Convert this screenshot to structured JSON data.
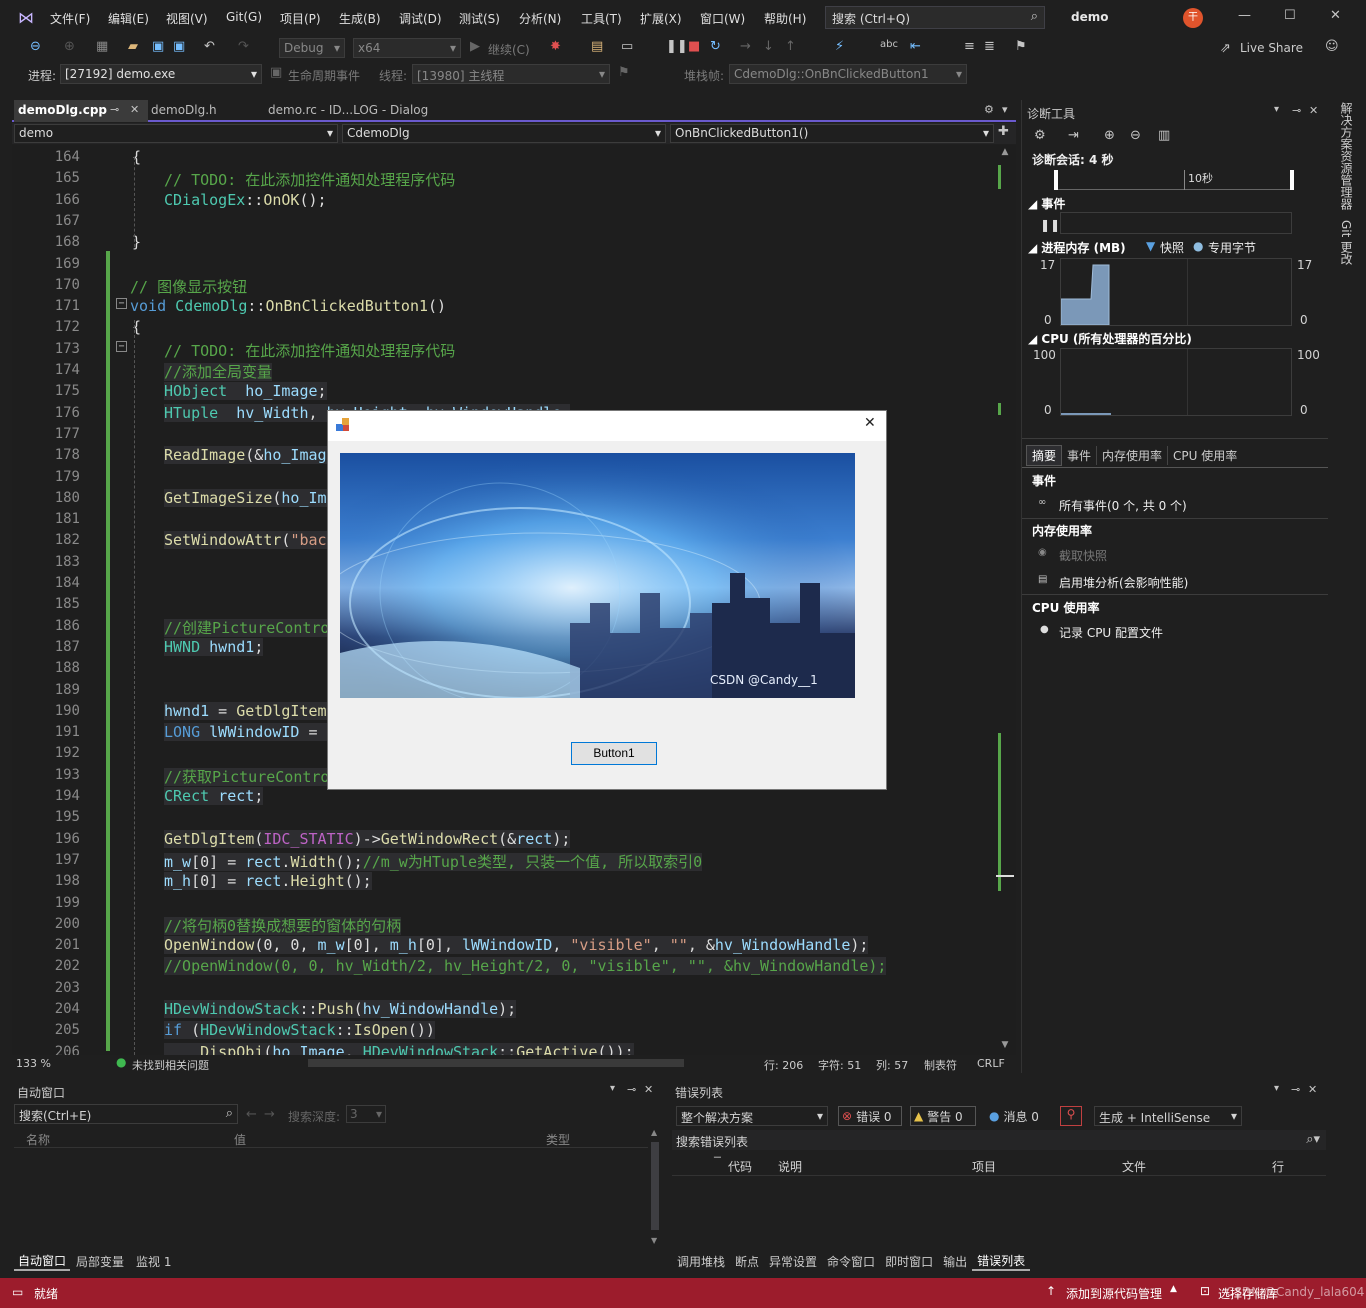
{
  "menubar": {
    "items": [
      "文件(F)",
      "编辑(E)",
      "视图(V)",
      "Git(G)",
      "项目(P)",
      "生成(B)",
      "调试(D)",
      "测试(S)",
      "分析(N)",
      "工具(T)",
      "扩展(X)",
      "窗口(W)",
      "帮助(H)"
    ],
    "search": "搜索 (Ctrl+Q)",
    "solution": "demo",
    "live_share": "Live Share"
  },
  "toolbar": {
    "config": "Debug",
    "platform": "x64",
    "continue": "继续(C)",
    "process_label": "进程:",
    "process": "[27192] demo.exe",
    "lifecycle": "生命周期事件",
    "thread_label": "线程:",
    "thread": "[13980] 主线程",
    "stack_label": "堆栈帧:",
    "stack": "CdemoDlg::OnBnClickedButton1"
  },
  "tabs": {
    "active": "demoDlg.cpp",
    "t2": "demoDlg.h",
    "t3": "demo.rc - ID...LOG - Dialog"
  },
  "nav": {
    "project": "demo",
    "class": "CdemoDlg",
    "member": "OnBnClickedButton1()"
  },
  "editor": {
    "lines": [
      {
        "n": "164",
        "html": "<span>{</span>",
        "indent": 120
      },
      {
        "n": "165",
        "html": "<span class='cm'>// TODO: 在此添加控件通知处理程序代码</span>",
        "indent": 152
      },
      {
        "n": "166",
        "html": "<span class='ty'>CDialogEx</span>::<span class='fn'>OnOK</span>();",
        "indent": 152
      },
      {
        "n": "167",
        "html": "",
        "indent": 152
      },
      {
        "n": "168",
        "html": "}",
        "indent": 120
      },
      {
        "n": "169",
        "html": "",
        "indent": 120
      },
      {
        "n": "170",
        "html": "<span class='cm'>// 图像显示按钮</span>",
        "indent": 118
      },
      {
        "n": "171",
        "html": "<span class='kw'>void</span> <span class='ty'>CdemoDlg</span>::<span class='fn'>OnBnClickedButton1</span>()",
        "indent": 118
      },
      {
        "n": "172",
        "html": "{",
        "indent": 120
      },
      {
        "n": "173",
        "html": "<span class='cm'>// TODO: 在此添加控件通知处理程序代码</span>",
        "indent": 152
      },
      {
        "n": "174",
        "html": "<span class='cm sel'>//添加全局变量</span>",
        "indent": 152
      },
      {
        "n": "175",
        "html": "<span class='sel'><span class='ty'>HObject</span>  <span class='vr'>ho_Image</span>;</span>",
        "indent": 152
      },
      {
        "n": "176",
        "html": "<span class='sel'><span class='ty'>HTuple</span>  <span class='vr'>hv_Width</span>, <span class='vr'>hv_Height</span>, <span class='vr'>hv_WindowHandle</span>;</span>",
        "indent": 152
      },
      {
        "n": "177",
        "html": "",
        "indent": 152
      },
      {
        "n": "178",
        "html": "<span class='sel'><span class='fn'>ReadImage</span>(&amp;<span class='vr'>ho_Image</span></span>",
        "indent": 152
      },
      {
        "n": "179",
        "html": "",
        "indent": 152
      },
      {
        "n": "180",
        "html": "<span class='sel'><span class='fn'>GetImageSize</span>(<span class='vr'>ho_Ima</span></span>",
        "indent": 152
      },
      {
        "n": "181",
        "html": "",
        "indent": 152
      },
      {
        "n": "182",
        "html": "<span class='sel'><span class='fn'>SetWindowAttr</span>(<span class='st'>\"back</span></span>",
        "indent": 152
      },
      {
        "n": "183",
        "html": "",
        "indent": 152
      },
      {
        "n": "184",
        "html": "",
        "indent": 152
      },
      {
        "n": "185",
        "html": "",
        "indent": 152
      },
      {
        "n": "186",
        "html": "<span class='cm sel'>//创建PictureContro</span>",
        "indent": 152
      },
      {
        "n": "187",
        "html": "<span class='sel'><span class='ty'>HWND</span> <span class='vr'>hwnd1</span>;</span>",
        "indent": 152
      },
      {
        "n": "188",
        "html": "",
        "indent": 152
      },
      {
        "n": "189",
        "html": "",
        "indent": 152
      },
      {
        "n": "190",
        "html": "<span class='sel'><span class='vr'>hwnd1</span> = <span class='fn'>GetDlgItem</span></span>",
        "indent": 152
      },
      {
        "n": "191",
        "html": "<span class='sel'><span class='kw'>LONG</span> <span class='vr'>lWWindowID</span> = (</span>",
        "indent": 152
      },
      {
        "n": "192",
        "html": "",
        "indent": 152
      },
      {
        "n": "193",
        "html": "<span class='cm sel'>//获取PictureContro</span>",
        "indent": 152
      },
      {
        "n": "194",
        "html": "<span class='sel'><span class='ty'>CRect</span> <span class='vr'>rect</span>;</span>",
        "indent": 152
      },
      {
        "n": "195",
        "html": "",
        "indent": 152
      },
      {
        "n": "196",
        "html": "<span class='sel'><span class='fn'>GetDlgItem</span>(<span class='mac'>IDC_STATIC</span>)-&gt;<span class='fn'>GetWindowRect</span>(&amp;<span class='vr'>rect</span>);</span>",
        "indent": 152
      },
      {
        "n": "197",
        "html": "<span class='sel'><span class='vr'>m_w</span>[0] = <span class='vr'>rect</span>.<span class='fn'>Width</span>();<span class='cm'>//m_w为HTuple类型, 只装一个值, 所以取索引0</span></span>",
        "indent": 152
      },
      {
        "n": "198",
        "html": "<span class='sel'><span class='vr'>m_h</span>[0] = <span class='vr'>rect</span>.<span class='fn'>Height</span>();</span>",
        "indent": 152
      },
      {
        "n": "199",
        "html": "",
        "indent": 152
      },
      {
        "n": "200",
        "html": "<span class='cm sel'>//将句柄0替换成想要的窗体的句柄</span>",
        "indent": 152
      },
      {
        "n": "201",
        "html": "<span class='sel'><span class='fn'>OpenWindow</span>(0, 0, <span class='vr'>m_w</span>[0], <span class='vr'>m_h</span>[0], <span class='vr'>lWWindowID</span>, <span class='st'>\"visible\"</span>, <span class='st'>\"\"</span>, &amp;<span class='vr'>hv_WindowHandle</span>);</span>",
        "indent": 152
      },
      {
        "n": "202",
        "html": "<span class='cm sel'>//OpenWindow(0, 0, hv_Width/2, hv_Height/2, 0, \"visible\", \"\", &amp;hv_WindowHandle);</span>",
        "indent": 152
      },
      {
        "n": "203",
        "html": "",
        "indent": 152
      },
      {
        "n": "204",
        "html": "<span class='sel'><span class='ty'>HDevWindowStack</span>::<span class='fn'>Push</span>(<span class='vr'>hv_WindowHandle</span>);</span>",
        "indent": 152
      },
      {
        "n": "205",
        "html": "<span class='sel'><span class='kw'>if</span> (<span class='ty'>HDevWindowStack</span>::<span class='fn'>IsOpen</span>())</span>",
        "indent": 152
      },
      {
        "n": "206",
        "html": "<span class='sel'>    <span class='fn'>DispObj</span>(<span class='vr'>ho_Image</span>, <span class='ty'>HDevWindowStack</span>::<span class='fn'>GetActive</span>());</span>",
        "indent": 152
      }
    ]
  },
  "status_edit": {
    "zoom": "133 %",
    "issues": "未找到相关问题",
    "row": "行: 206",
    "char": "字符: 51",
    "col": "列: 57",
    "tab": "制表符",
    "eol": "CRLF"
  },
  "diag": {
    "title": "诊断工具",
    "session": "诊断会话: 4 秒",
    "tick": "10秒",
    "events": "事件",
    "mem": "进程内存 (MB)",
    "snapshot": "快照",
    "private": "专用字节",
    "mem_max": "17",
    "mem_min": "0",
    "cpu": "CPU (所有处理器的百分比)",
    "cpu_max": "100",
    "cpu_min": "0",
    "tabs": [
      "摘要",
      "事件",
      "内存使用率",
      "CPU 使用率"
    ],
    "s_events": "事件",
    "all_events": "所有事件(0 个, 共 0 个)",
    "s_mem": "内存使用率",
    "take_snapshot": "截取快照",
    "heap": "启用堆分析(会影响性能)",
    "s_cpu": "CPU 使用率",
    "record_cpu": "记录 CPU 配置文件"
  },
  "right_strip": {
    "a": "解决方案资源管理器",
    "b": "Git 更改"
  },
  "dialog": {
    "button": "Button1",
    "watermark": "CSDN @Candy__1"
  },
  "autowin": {
    "title": "自动窗口",
    "search": "搜索(Ctrl+E)",
    "depth_label": "搜索深度:",
    "depth": "3",
    "col_name": "名称",
    "col_value": "值",
    "col_type": "类型",
    "tabs": [
      "自动窗口",
      "局部变量",
      "监视 1"
    ]
  },
  "errlist": {
    "title": "错误列表",
    "scope": "整个解决方案",
    "errors": "错误 0",
    "warnings": "警告 0",
    "messages": "消息 0",
    "build": "生成 + IntelliSense",
    "search": "搜索错误列表",
    "col_code": "代码",
    "col_desc": "说明",
    "col_proj": "项目",
    "col_file": "文件",
    "col_line": "行",
    "tabs": [
      "调用堆栈",
      "断点",
      "异常设置",
      "命令窗口",
      "即时窗口",
      "输出",
      "错误列表"
    ]
  },
  "statusbar": {
    "ready": "就绪",
    "source_control": "添加到源代码管理",
    "repo": "选择存储库",
    "watermark": "CSDN @Candy_lala604"
  }
}
